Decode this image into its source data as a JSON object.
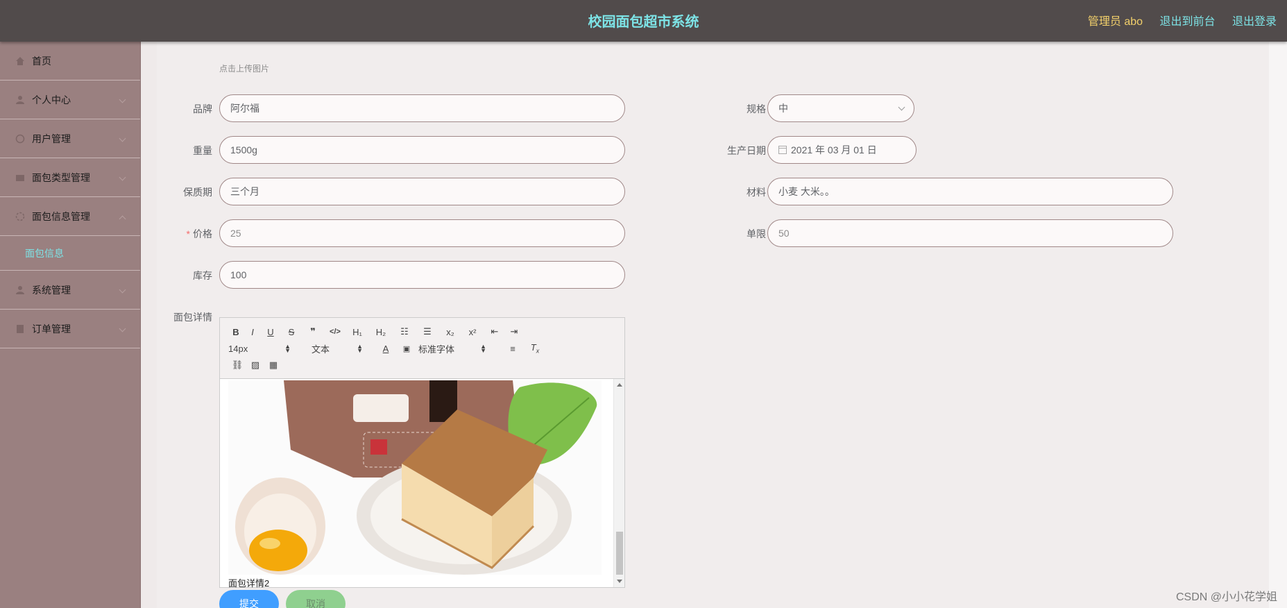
{
  "header": {
    "title": "校园面包超市系统",
    "admin": "管理员 abo",
    "to_frontend": "退出到前台",
    "logout": "退出登录"
  },
  "sidebar": {
    "items": [
      {
        "label": "首页",
        "icon": "home-icon"
      },
      {
        "label": "个人中心",
        "icon": "user-icon"
      },
      {
        "label": "用户管理",
        "icon": "users-icon"
      },
      {
        "label": "面包类型管理",
        "icon": "category-icon"
      },
      {
        "label": "面包信息管理",
        "icon": "info-icon"
      },
      {
        "label": "系统管理",
        "icon": "system-icon"
      },
      {
        "label": "订单管理",
        "icon": "order-icon"
      }
    ],
    "active_sub": "面包信息"
  },
  "form": {
    "upload_hint": "点击上传图片",
    "brand_label": "品牌",
    "brand_value": "阿尔福",
    "spec_label": "规格",
    "spec_value": "中",
    "weight_label": "重量",
    "weight_value": "1500g",
    "date_label": "生产日期",
    "date_value": "2021 年 03 月 01 日",
    "shelf_label": "保质期",
    "shelf_value": "三个月",
    "material_label": "材料",
    "material_value": "小麦 大米。。",
    "price_label": "价格",
    "price_value": "25",
    "limit_label": "单限",
    "limit_value": "50",
    "stock_label": "库存",
    "stock_value": "100",
    "detail_label": "面包详情"
  },
  "editor": {
    "font_size": "14px",
    "block_type": "文本",
    "font_family": "标准字体",
    "body_text": "面包详情2"
  },
  "buttons": {
    "submit": "提交",
    "cancel": "取消"
  },
  "watermark": "CSDN @小小花学姐",
  "colors": {
    "header_bg": "#514b4b",
    "title": "#7de3e6",
    "admin": "#f2d06b",
    "sidebar_bg": "#9a8080",
    "submit": "#409eff",
    "cancel": "#8fd08f"
  }
}
